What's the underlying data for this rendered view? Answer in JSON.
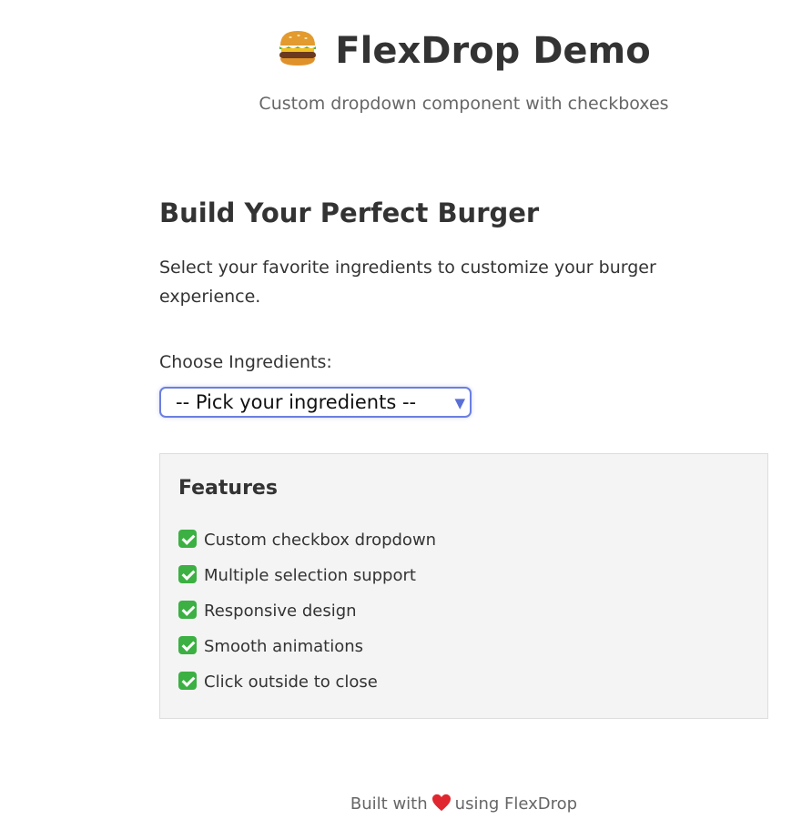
{
  "header": {
    "title": "FlexDrop Demo",
    "title_icon": "burger-icon",
    "subtitle": "Custom dropdown component with checkboxes"
  },
  "main": {
    "section_title": "Build Your Perfect Burger",
    "description": "Select your favorite ingredients to customize your burger experience.",
    "field_label": "Choose Ingredients:",
    "dropdown": {
      "placeholder": "-- Pick your ingredients --",
      "arrow_icon": "triangle-down-icon",
      "accent_color": "#6b7fe0"
    }
  },
  "features": {
    "title": "Features",
    "items": [
      {
        "icon": "check-icon",
        "label": "Custom checkbox dropdown"
      },
      {
        "icon": "check-icon",
        "label": "Multiple selection support"
      },
      {
        "icon": "check-icon",
        "label": "Responsive design"
      },
      {
        "icon": "check-icon",
        "label": "Smooth animations"
      },
      {
        "icon": "check-icon",
        "label": "Click outside to close"
      }
    ]
  },
  "footer": {
    "prefix": "Built with",
    "icon": "heart-icon",
    "suffix": "using FlexDrop"
  }
}
